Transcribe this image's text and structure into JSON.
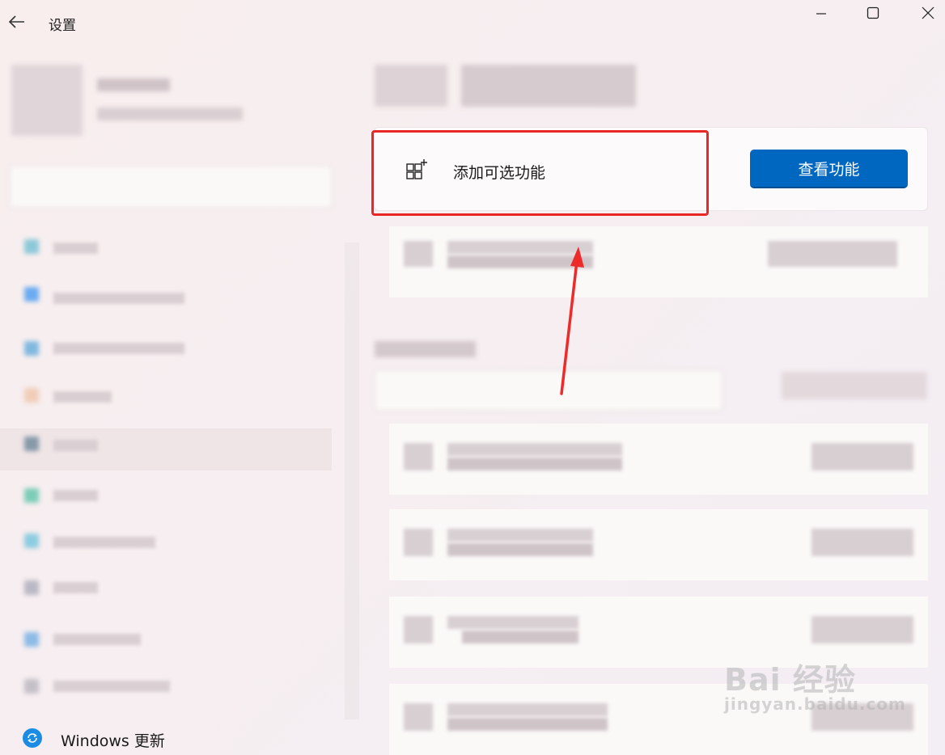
{
  "window": {
    "title": "设置"
  },
  "main": {
    "add_feature": {
      "label": "添加可选功能",
      "button_label": "查看功能"
    }
  },
  "sidebar": {
    "footer_item": {
      "label": "Windows 更新"
    }
  },
  "watermark": {
    "brand": "Bai 经验",
    "url": "jingyan.baidu.com"
  },
  "colors": {
    "accent": "#0067c0",
    "highlight_box": "#ea2727",
    "annotation_arrow": "#ee2b2b"
  }
}
